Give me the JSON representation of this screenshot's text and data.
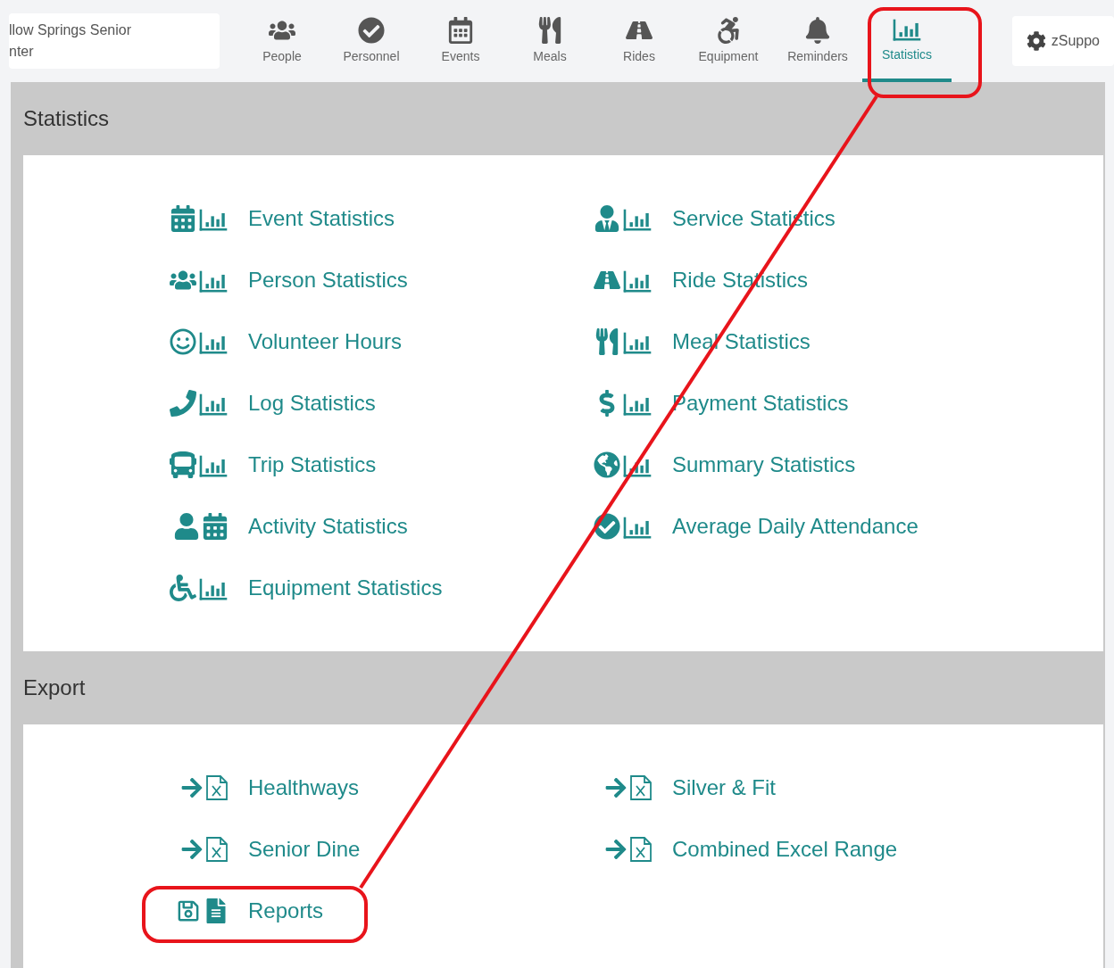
{
  "org": {
    "lines": [
      "llow Springs Senior",
      "nter"
    ]
  },
  "nav": [
    {
      "label": "People",
      "selected": false
    },
    {
      "label": "Personnel",
      "selected": false
    },
    {
      "label": "Events",
      "selected": false
    },
    {
      "label": "Meals",
      "selected": false
    },
    {
      "label": "Rides",
      "selected": false
    },
    {
      "label": "Equipment",
      "selected": false
    },
    {
      "label": "Reminders",
      "selected": false
    },
    {
      "label": "Statistics",
      "selected": true
    }
  ],
  "settings": {
    "label": "zSuppo"
  },
  "sections": [
    {
      "title": "Statistics",
      "items": [
        {
          "label": "Event Statistics"
        },
        {
          "label": "Service Statistics"
        },
        {
          "label": "Person Statistics"
        },
        {
          "label": "Ride Statistics"
        },
        {
          "label": "Volunteer Hours"
        },
        {
          "label": "Meal Statistics"
        },
        {
          "label": "Log Statistics"
        },
        {
          "label": "Payment Statistics"
        },
        {
          "label": "Trip Statistics"
        },
        {
          "label": "Summary Statistics"
        },
        {
          "label": "Activity Statistics"
        },
        {
          "label": "Average Daily Attendance"
        },
        {
          "label": "Equipment Statistics"
        }
      ]
    },
    {
      "title": "Export",
      "items": [
        {
          "label": "Healthways"
        },
        {
          "label": "Silver & Fit"
        },
        {
          "label": "Senior Dine"
        },
        {
          "label": "Combined Excel Range"
        },
        {
          "label": "Reports"
        }
      ]
    }
  ]
}
